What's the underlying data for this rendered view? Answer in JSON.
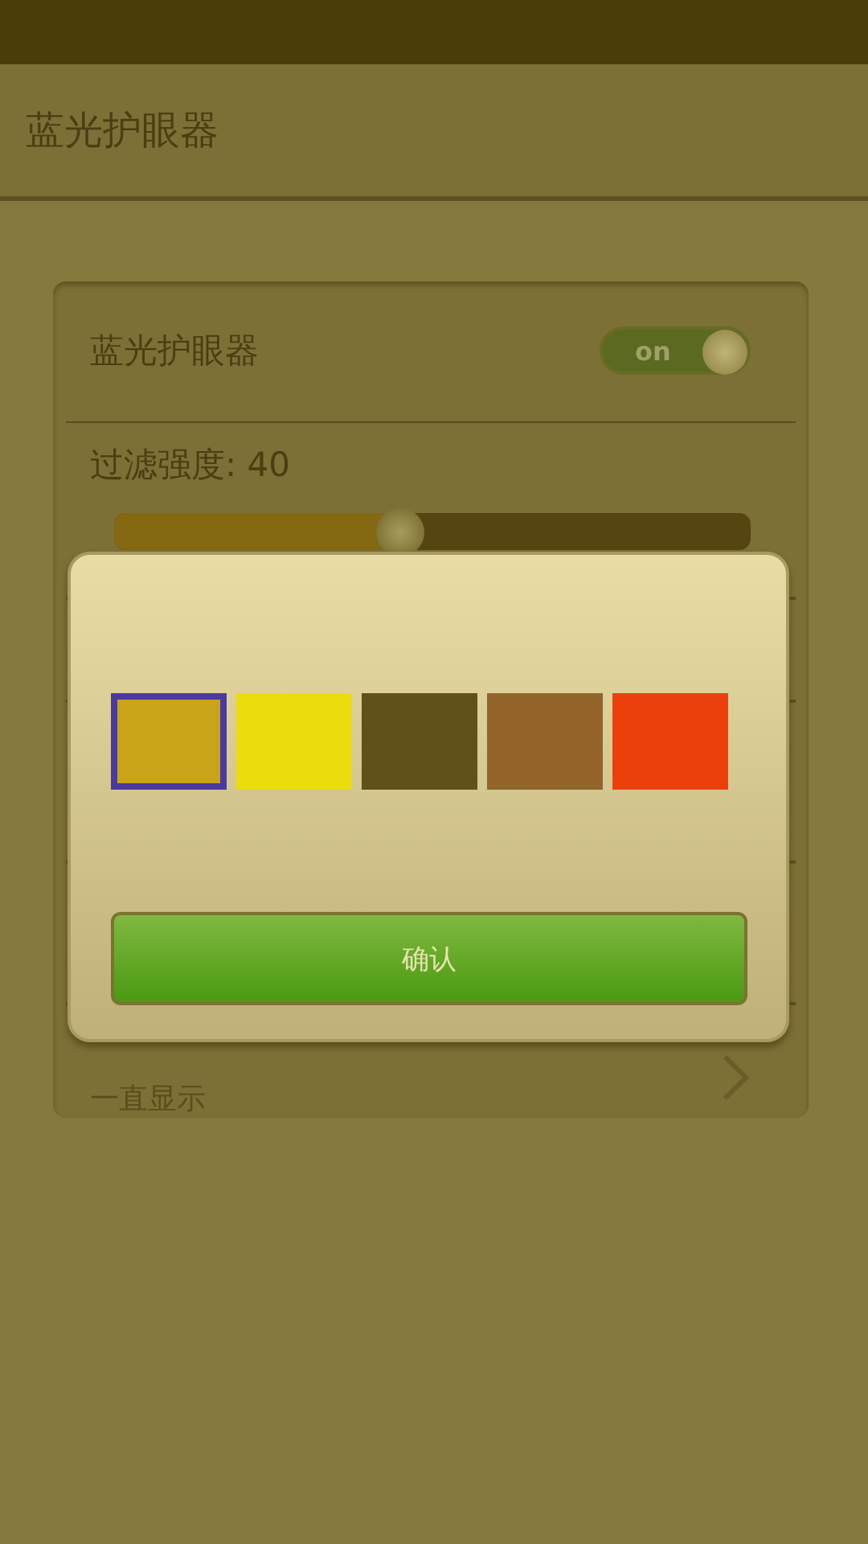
{
  "header": {
    "title": "蓝光护眼器"
  },
  "toggle_row": {
    "label": "蓝光护眼器",
    "on": true,
    "toggle_text": "on"
  },
  "filter": {
    "label": "过滤强度: 40",
    "level": 0.45
  },
  "notice_row": {
    "subtitle": "一直显示"
  },
  "dialog": {
    "swatches": [
      {
        "color": "#c9a418",
        "selected": true
      },
      {
        "color": "#ebdd0c",
        "selected": false
      },
      {
        "color": "#5f5119",
        "selected": false
      },
      {
        "color": "#93652a",
        "selected": false
      },
      {
        "color": "#ec400c",
        "selected": false
      }
    ],
    "confirm": "确认"
  }
}
